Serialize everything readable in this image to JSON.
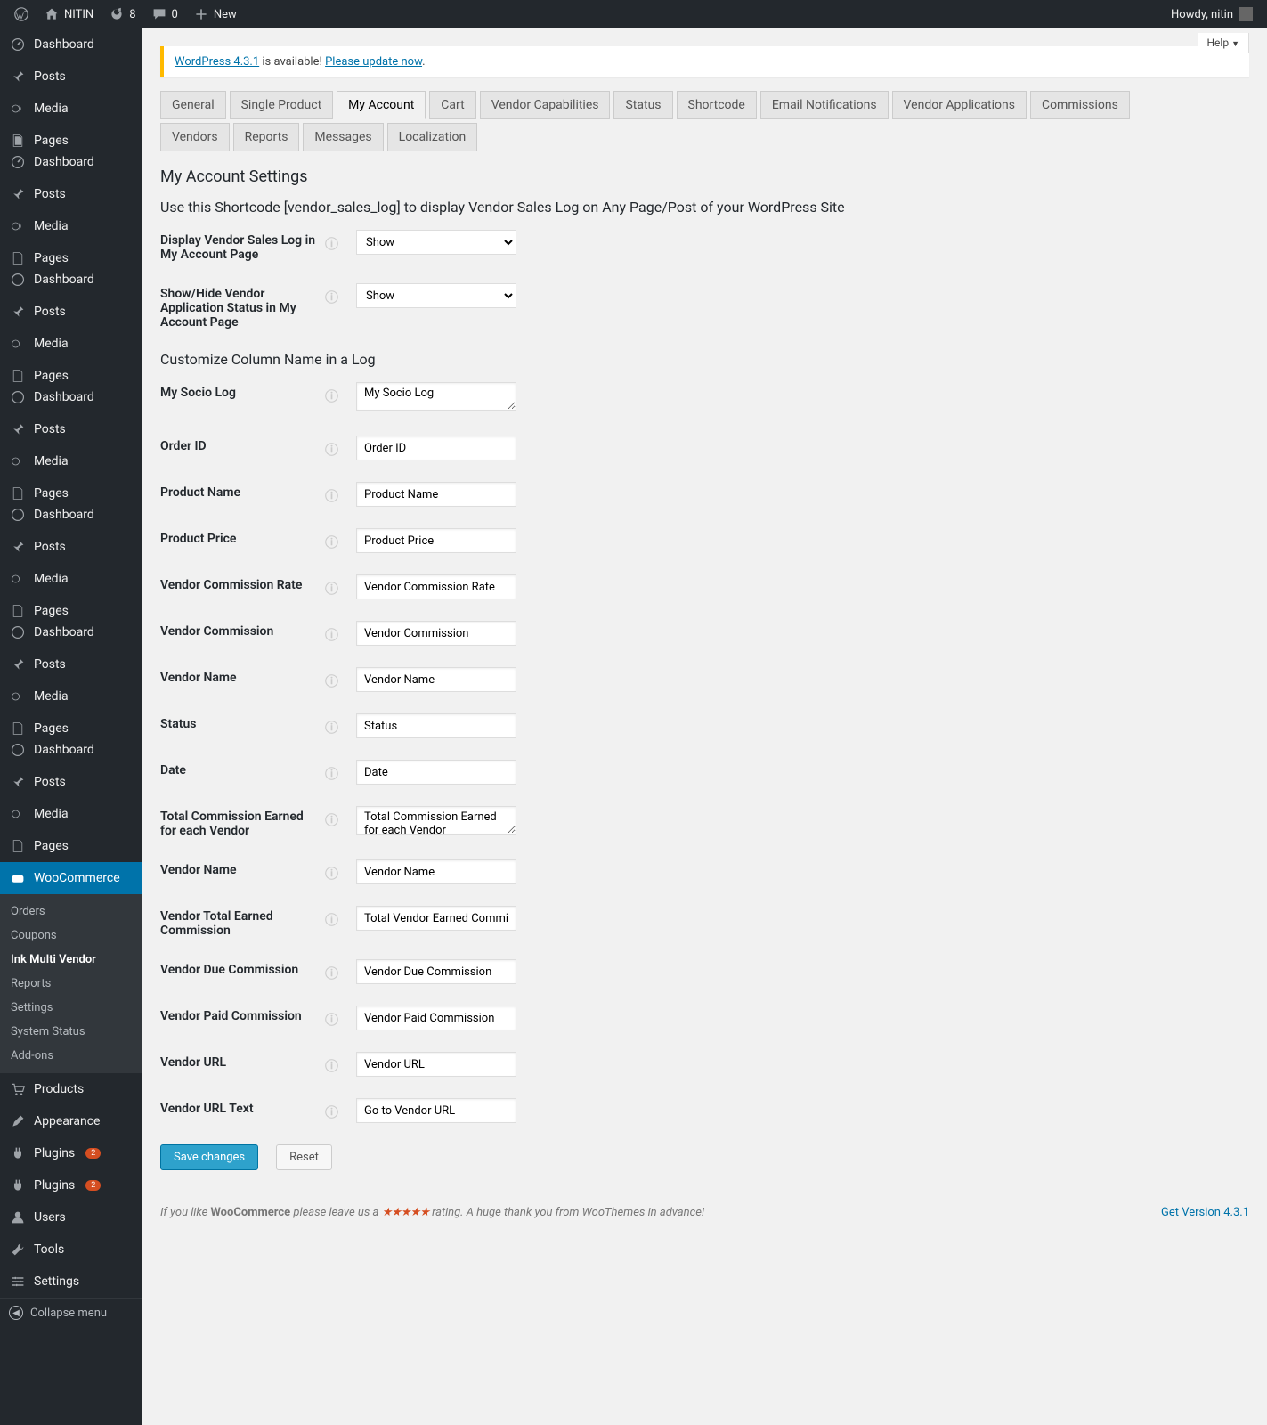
{
  "adminbar": {
    "site_name": "NITIN",
    "updates": "8",
    "comments": "0",
    "new": "New",
    "howdy": "Howdy, nitin"
  },
  "sidebar": {
    "dashboard": "Dashboard",
    "posts": "Posts",
    "media": "Media",
    "pages": "Pages",
    "woocommerce": "WooCommerce",
    "products": "Products",
    "appearance": "Appearance",
    "plugins": "Plugins",
    "plugins_badge": "2",
    "users": "Users",
    "tools": "Tools",
    "settings": "Settings",
    "collapse": "Collapse menu",
    "sub_orders": "Orders",
    "sub_coupons": "Coupons",
    "sub_ink": "Ink Multi Vendor",
    "sub_reports": "Reports",
    "sub_settings": "Settings",
    "sub_status": "System Status",
    "sub_addons": "Add-ons"
  },
  "help": "Help",
  "notice": {
    "pre": "WordPress 4.3.1",
    "mid": " is available! ",
    "link": "Please update now"
  },
  "tabs": {
    "general": "General",
    "single_product": "Single Product",
    "my_account": "My Account",
    "cart": "Cart",
    "vendor_capabilities": "Vendor Capabilities",
    "status": "Status",
    "shortcode": "Shortcode",
    "email": "Email Notifications",
    "vendor_apps": "Vendor Applications",
    "commissions": "Commissions",
    "vendors": "Vendors",
    "reports": "Reports",
    "messages": "Messages",
    "localization": "Localization"
  },
  "headings": {
    "h1": "My Account Settings",
    "h2": "Use this Shortcode [vendor_sales_log] to display Vendor Sales Log on Any Page/Post of your WordPress Site",
    "h3": "Customize Column Name in a Log"
  },
  "selects": {
    "show": "Show"
  },
  "fields": {
    "display_log": {
      "label": "Display Vendor Sales Log in My Account Page"
    },
    "app_status": {
      "label": "Show/Hide Vendor Application Status in My Account Page"
    },
    "socio": {
      "label": "My Socio Log",
      "val": "My Socio Log"
    },
    "order_id": {
      "label": "Order ID",
      "val": "Order ID"
    },
    "product_name": {
      "label": "Product Name",
      "val": "Product Name"
    },
    "product_price": {
      "label": "Product Price",
      "val": "Product Price"
    },
    "comm_rate": {
      "label": "Vendor Commission Rate",
      "val": "Vendor Commission Rate"
    },
    "vendor_comm": {
      "label": "Vendor Commission",
      "val": "Vendor Commission"
    },
    "vendor_name": {
      "label": "Vendor Name",
      "val": "Vendor Name"
    },
    "status": {
      "label": "Status",
      "val": "Status"
    },
    "date": {
      "label": "Date",
      "val": "Date"
    },
    "total_comm": {
      "label": "Total Commission Earned for each Vendor",
      "val": "Total Commission Earned for each Vendor"
    },
    "vendor_name2": {
      "label": "Vendor Name",
      "val": "Vendor Name"
    },
    "total_earned": {
      "label": "Vendor Total Earned Commission",
      "val": "Total Vendor Earned Commission"
    },
    "due_comm": {
      "label": "Vendor Due Commission",
      "val": "Vendor Due Commission"
    },
    "paid_comm": {
      "label": "Vendor Paid Commission",
      "val": "Vendor Paid Commission"
    },
    "vendor_url": {
      "label": "Vendor URL",
      "val": "Vendor URL"
    },
    "url_text": {
      "label": "Vendor URL Text",
      "val": "Go to Vendor URL"
    }
  },
  "buttons": {
    "save": "Save changes",
    "reset": "Reset"
  },
  "footer": {
    "pre": "If you like ",
    "woo": "WooCommerce",
    "mid": " please leave us a ",
    "post": " rating. A huge thank you from WooThemes in advance!",
    "version": "Get Version 4.3.1"
  }
}
